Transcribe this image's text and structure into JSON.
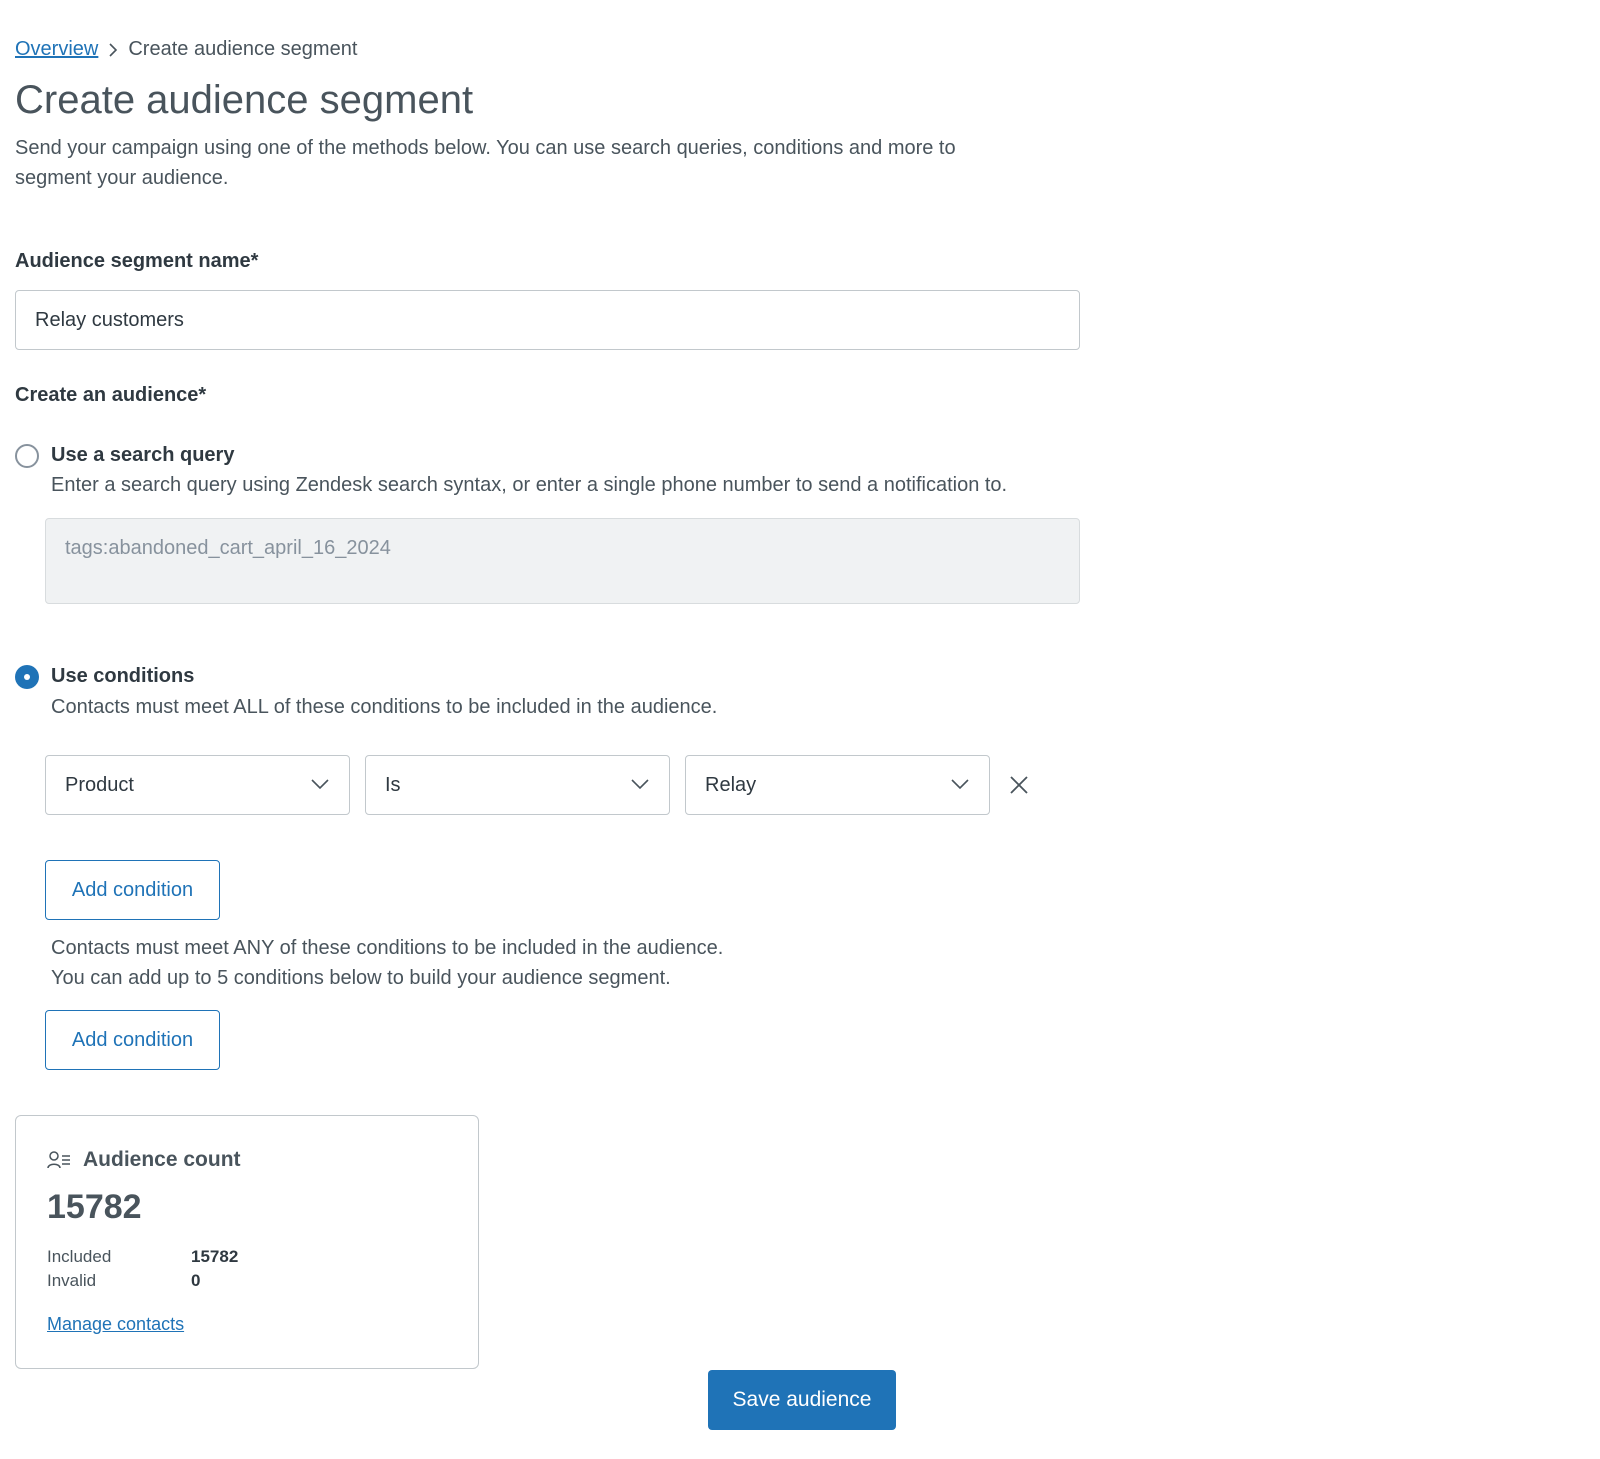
{
  "breadcrumb": {
    "parent": "Overview",
    "current": "Create audience segment"
  },
  "page": {
    "title": "Create audience segment",
    "description": "Send your campaign using one of the methods below. You can use search queries, conditions and more to segment your audience."
  },
  "segment_name": {
    "label": "Audience segment name*",
    "value": "Relay customers"
  },
  "audience": {
    "label": "Create an audience*"
  },
  "search_option": {
    "label": "Use a search query",
    "hint": "Enter a search query using Zendesk search syntax, or enter a single phone number to send a notification to.",
    "query": "tags:abandoned_cart_april_16_2024",
    "selected": false
  },
  "conditions_option": {
    "label": "Use conditions",
    "hint_all": "Contacts must meet ALL of these conditions to be included in the audience.",
    "selected": true,
    "condition": {
      "field": "Product",
      "operator": "Is",
      "value": "Relay"
    },
    "add_condition_label": "Add condition",
    "hint_any_1": "Contacts must meet ANY of these conditions to be included in the audience.",
    "hint_any_2": "You can add up to 5 conditions below to build your audience segment."
  },
  "audience_count": {
    "title": "Audience count",
    "total": "15782",
    "included_label": "Included",
    "included_value": "15782",
    "invalid_label": "Invalid",
    "invalid_value": "0",
    "manage_link": "Manage contacts"
  },
  "actions": {
    "save_label": "Save audience"
  },
  "colors": {
    "accent": "#1f73b7",
    "text": "#2f3941",
    "muted": "#49545c",
    "border": "#c2c8cc"
  }
}
